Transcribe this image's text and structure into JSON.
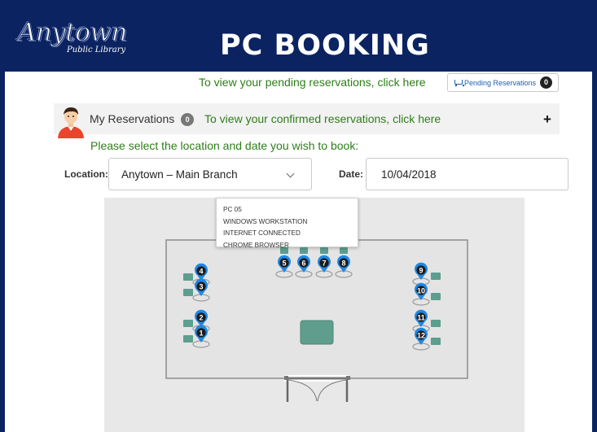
{
  "header": {
    "logo_script": "Anytown",
    "logo_sub": "Public Library",
    "title": "PC BOOKING"
  },
  "pending": {
    "link_text": "To view your pending reservations, click here",
    "button_label": "Pending Reservations",
    "count": "0"
  },
  "reservations": {
    "label": "My Reservations",
    "count": "0",
    "link_text": "To view your confirmed reservations, click here",
    "expand_symbol": "+"
  },
  "booking": {
    "prompt": "Please select the location and date you wish to book:",
    "location_label": "Location:",
    "location_value": "Anytown – Main Branch",
    "date_label": "Date:",
    "date_value": "10/04/2018"
  },
  "tooltip": {
    "lines": [
      "PC 05",
      "WINDOWS WORKSTATION",
      "INTERNET CONNECTED",
      "CHROME BROWSER"
    ]
  },
  "pcs": [
    "1",
    "2",
    "3",
    "4",
    "5",
    "6",
    "7",
    "8",
    "9",
    "10",
    "11",
    "12"
  ],
  "colors": {
    "header_bg": "#0b2361",
    "link_green": "#2e7d1a",
    "marker_blue": "#1e88e5",
    "seat_teal": "#5c9e8f",
    "table_teal": "#5f9e8c"
  }
}
